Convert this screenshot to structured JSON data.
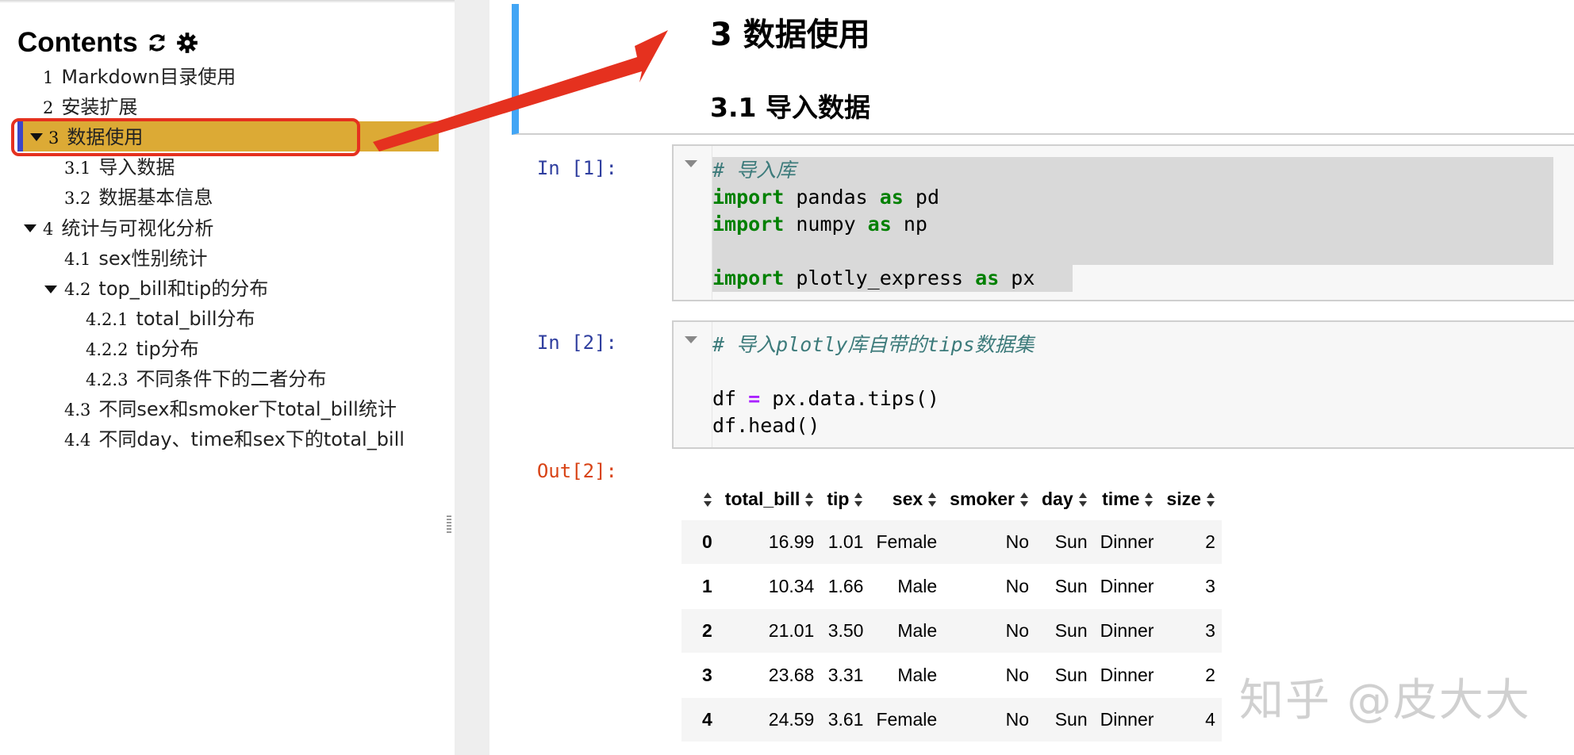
{
  "toc": {
    "title": "Contents",
    "refresh_icon": "refresh-icon",
    "settings_icon": "gear-icon",
    "items": [
      {
        "num": "1",
        "label": "Markdown目录使用"
      },
      {
        "num": "2",
        "label": "安装扩展"
      },
      {
        "num": "3",
        "label": "数据使用"
      },
      {
        "num": "3.1",
        "label": "导入数据"
      },
      {
        "num": "3.2",
        "label": "数据基本信息"
      },
      {
        "num": "4",
        "label": "统计与可视化分析"
      },
      {
        "num": "4.1",
        "label": "sex性别统计"
      },
      {
        "num": "4.2",
        "label": "top_bill和tip的分布"
      },
      {
        "num": "4.2.1",
        "label": "total_bill分布"
      },
      {
        "num": "4.2.2",
        "label": "tip分布"
      },
      {
        "num": "4.2.3",
        "label": "不同条件下的二者分布"
      },
      {
        "num": "4.3",
        "label": "不同sex和smoker下total_bill统计"
      },
      {
        "num": "4.4",
        "label": "不同day、time和sex下的total_bill"
      }
    ]
  },
  "notebook": {
    "heading1": "3  数据使用",
    "heading2": "3.1  导入数据",
    "cells": [
      {
        "prompt": "In [1]:",
        "lines": [
          "# 导入库",
          "import pandas as pd",
          "import numpy as np",
          "",
          "import plotly_express as px"
        ]
      },
      {
        "prompt": "In [2]:",
        "lines": [
          "# 导入plotly库自带的tips数据集",
          "",
          "df = px.data.tips()",
          "df.head()"
        ]
      }
    ],
    "output_prompt": "Out[2]:",
    "table": {
      "columns": [
        "",
        "total_bill",
        "tip",
        "sex",
        "smoker",
        "day",
        "time",
        "size"
      ],
      "rows": [
        [
          "0",
          "16.99",
          "1.01",
          "Female",
          "No",
          "Sun",
          "Dinner",
          "2"
        ],
        [
          "1",
          "10.34",
          "1.66",
          "Male",
          "No",
          "Sun",
          "Dinner",
          "3"
        ],
        [
          "2",
          "21.01",
          "3.50",
          "Male",
          "No",
          "Sun",
          "Dinner",
          "3"
        ],
        [
          "3",
          "23.68",
          "3.31",
          "Male",
          "No",
          "Sun",
          "Dinner",
          "2"
        ],
        [
          "4",
          "24.59",
          "3.61",
          "Female",
          "No",
          "Sun",
          "Dinner",
          "4"
        ]
      ]
    }
  },
  "watermark": "知乎 @皮大大",
  "colors": {
    "toc_highlight": "#dcaa35",
    "annotation_red": "#e5311f",
    "header_accent": "#42a5f5",
    "keyword_green": "#008000"
  }
}
